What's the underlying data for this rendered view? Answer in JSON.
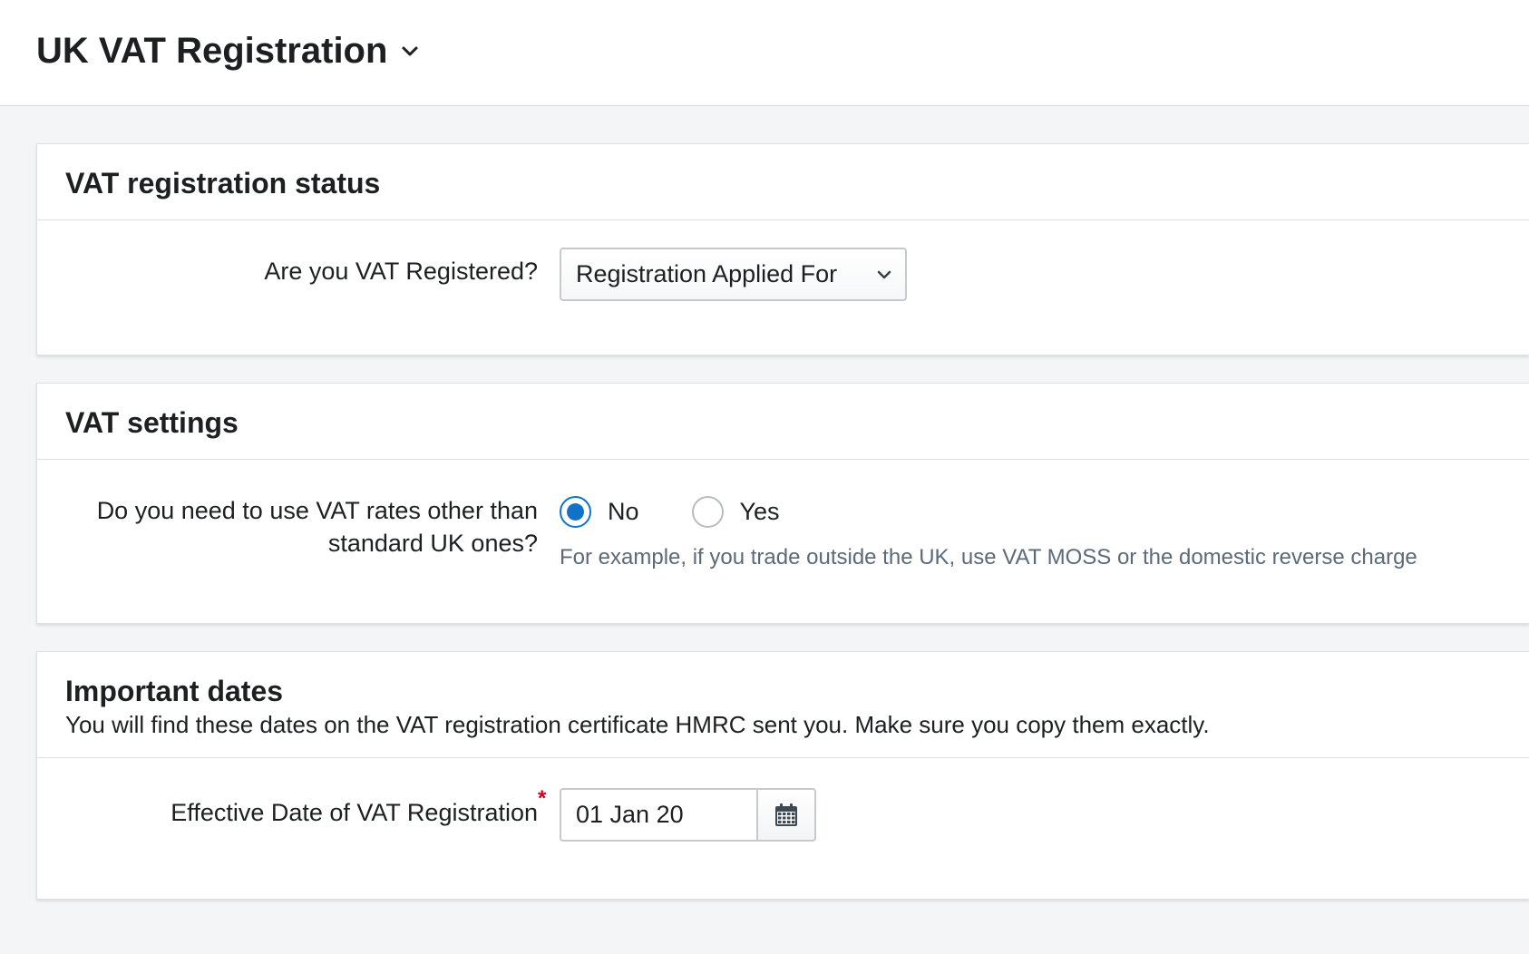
{
  "header": {
    "title": "UK VAT Registration"
  },
  "status_card": {
    "title": "VAT registration status",
    "question": "Are you VAT Registered?",
    "select_value": "Registration Applied For"
  },
  "settings_card": {
    "title": "VAT settings",
    "question_line1": "Do you need to use VAT rates other than",
    "question_line2": "standard UK ones?",
    "options": [
      {
        "label": "No",
        "checked": true
      },
      {
        "label": "Yes",
        "checked": false
      }
    ],
    "help": "For example, if you trade outside the UK, use VAT MOSS or the domestic reverse charge"
  },
  "dates_card": {
    "title": "Important dates",
    "subtitle": "You will find these dates on the VAT registration certificate HMRC sent you. Make sure you copy them exactly.",
    "effective_label": "Effective Date of VAT Registration",
    "required_marker": "*",
    "effective_value": "01 Jan 20"
  },
  "colors": {
    "accent": "#1173c7",
    "required": "#d0011b",
    "help_text": "#5a6a7a"
  },
  "icons": {
    "title_dropdown": "chevron-down-icon",
    "select_dropdown": "chevron-down-icon",
    "date_picker": "calendar-icon"
  }
}
